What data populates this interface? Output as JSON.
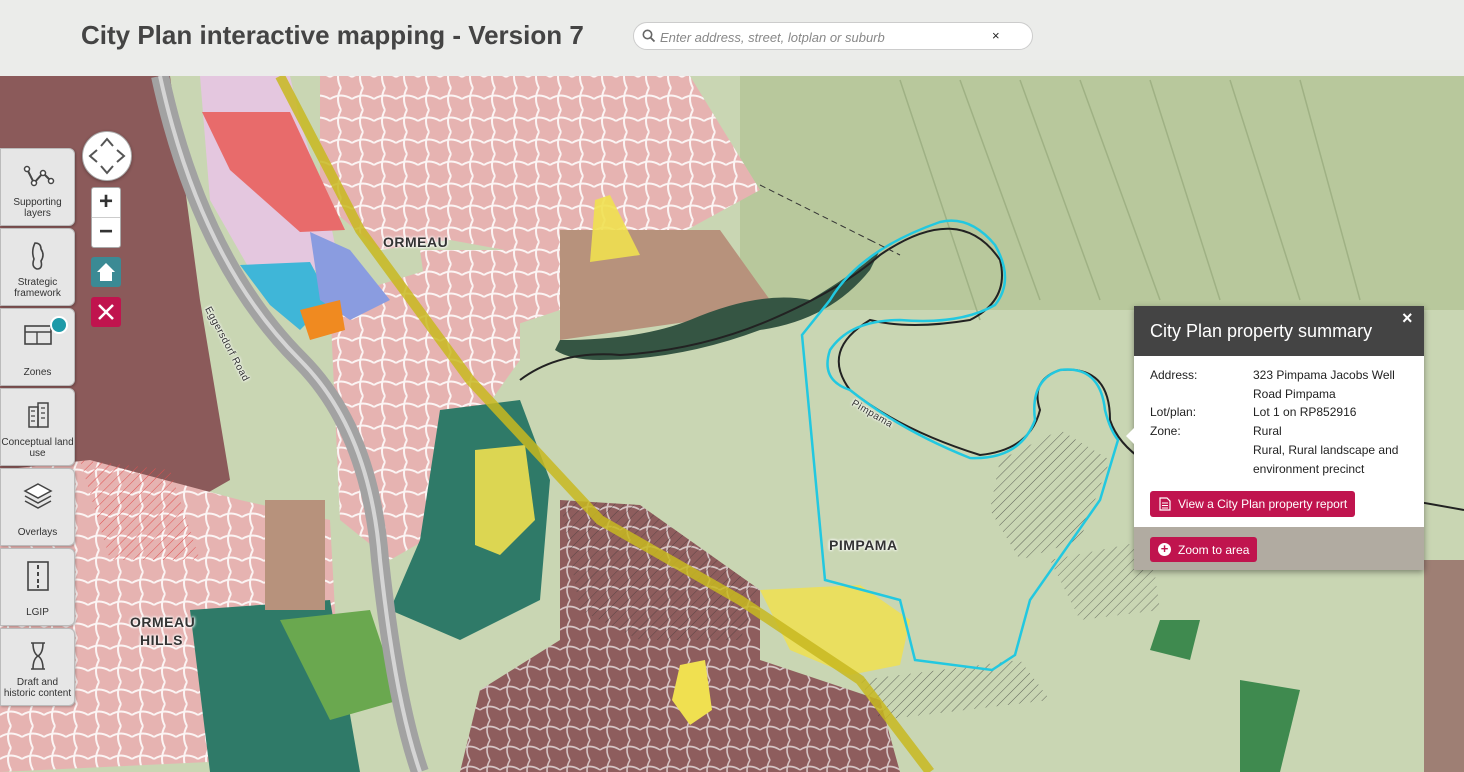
{
  "header": {
    "title": "City Plan interactive mapping - Version 7",
    "search_placeholder": "Enter address, street, lotplan or suburb",
    "clear_label": "×"
  },
  "sidebar": {
    "items": [
      {
        "label": "Supporting layers",
        "icon": "supporting-layers-icon"
      },
      {
        "label": "Strategic framework",
        "icon": "strategic-framework-icon"
      },
      {
        "label": "Zones",
        "icon": "zones-icon",
        "active": true
      },
      {
        "label": "Conceptual land use",
        "icon": "conceptual-land-use-icon"
      },
      {
        "label": "Overlays",
        "icon": "overlays-icon"
      },
      {
        "label": "LGIP",
        "icon": "lgip-icon"
      },
      {
        "label": "Draft and historic content",
        "icon": "hourglass-icon"
      }
    ]
  },
  "map_controls": {
    "zoom_in": "+",
    "zoom_out": "−"
  },
  "map_labels": {
    "ormeau": "ORMEAU",
    "ormeau_hills_1": "ORMEAU",
    "ormeau_hills_2": "HILLS",
    "pimpama": "PIMPAMA",
    "road": "Eggersdorf Road",
    "river": "Pimpama"
  },
  "popup": {
    "title": "City Plan property summary",
    "close": "×",
    "rows": [
      {
        "label": "Address:",
        "value": "323 Pimpama Jacobs Well Road Pimpama"
      },
      {
        "label": "Lot/plan:",
        "value": "Lot 1 on RP852916"
      },
      {
        "label": "Zone:",
        "value": "Rural"
      }
    ],
    "zone_extra": "Rural, Rural landscape and environment precinct",
    "report_button": "View a City Plan property report",
    "zoom_button": "Zoom to area"
  },
  "colors": {
    "accent": "#c0144e",
    "teal": "#3b8a94",
    "popup_header": "#444444",
    "residential": "#e8b7b5",
    "rural": "#c9d6b3",
    "industry": "#8b5a5a",
    "community": "#f0e050",
    "conservation": "#2f7a68"
  }
}
